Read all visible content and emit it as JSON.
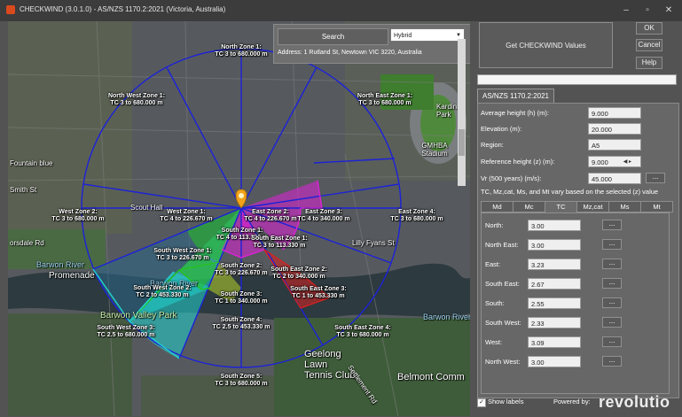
{
  "window": {
    "title": "CHECKWIND (3.0.1.0) - AS/NZS 1170.2:2021 (Victoria, Australia)",
    "minimize": "–",
    "maximize": "▫",
    "close": "✕"
  },
  "map": {
    "search_label": "Search",
    "map_type": "Hybrid",
    "address": "Address: 1 Rutland St, Newtown VIC 3220, Australia",
    "places": {
      "barwon_river_1": "Barwon River",
      "barwon_river_2": "Barwon River",
      "barwon_river_3": "Barwon River",
      "promenade": "Promenade",
      "park": "Barwon Valley Park",
      "belmont": "Belmont Comm",
      "tennis": "Geelong Lawn Tennis Club",
      "settlement": "Settlement Rd",
      "gmhba": "GMHBA Stadium",
      "fountain": "Fountain blue",
      "scout": "Scout Hall",
      "lilly_fyans": "Lilly Fyans St",
      "orsdale": "orsdale Rd",
      "smith": "Smith St",
      "kardinia": "Kardinia Park"
    },
    "outer_zones": [
      {
        "name": "North Zone 1:",
        "range": "TC 3 to 680.000 m"
      },
      {
        "name": "North East Zone 1:",
        "range": "TC 3 to 680.000 m"
      },
      {
        "name": "East Zone 4:",
        "range": "TC 3 to 680.000 m"
      },
      {
        "name": "South East Zone 4:",
        "range": "TC 3 to 680.000 m"
      },
      {
        "name": "South Zone 5:",
        "range": "TC 3 to 680.000 m"
      },
      {
        "name": "South West Zone 3:",
        "range": "TC 2.5 to 680.000 m"
      },
      {
        "name": "West Zone 2:",
        "range": "TC 3 to 680.000 m"
      },
      {
        "name": "North West Zone 1:",
        "range": "TC 3 to 680.000 m"
      }
    ],
    "inner_zones": [
      {
        "name": "West Zone 1:",
        "range": "TC 4 to 226.670 m"
      },
      {
        "name": "East Zone 2:",
        "range": "TC 4 to 226.670 m"
      },
      {
        "name": "East Zone 3:",
        "range": "TC 4 to 340.000 m"
      },
      {
        "name": "South Zone 1:",
        "range": "TC 4 to 113.330 m"
      },
      {
        "name": "South Zone 2:",
        "range": "TC 3 to 226.670 m"
      },
      {
        "name": "South Zone 3:",
        "range": "TC 1 to 340.000 m"
      },
      {
        "name": "South Zone 4:",
        "range": "TC 2.5 to 453.330 m"
      },
      {
        "name": "South West Zone 1:",
        "range": "TC 3 to 226.670 m"
      },
      {
        "name": "South West Zone 2:",
        "range": "TC 2 to 453.330 m"
      },
      {
        "name": "South East Zone 1:",
        "range": "TC 3 to 113.330 m"
      },
      {
        "name": "South East Zone 2:",
        "range": "TC 2 to 340.000 m"
      },
      {
        "name": "South East Zone 3:",
        "range": "TC 1 to 453.330 m"
      }
    ]
  },
  "panel": {
    "get_values": "Get CHECKWIND Values",
    "ok": "OK",
    "cancel": "Cancel",
    "help": "Help",
    "standard_tab": "AS/NZS 1170.2:2021",
    "avg_height_label": "Average height (h) (m):",
    "avg_height": "9.000",
    "elevation_label": "Elevation (m):",
    "elevation": "20.000",
    "region_label": "Region:",
    "region": "A5",
    "ref_height_label": "Reference height (z) (m):",
    "ref_height": "9.000",
    "vr_label": "Vr (500 years) (m/s):",
    "vr": "45.000",
    "vary_note": "TC, Mz,cat, Ms, and Mt vary based on the selected (z) value",
    "more": "...",
    "subtabs": [
      "Md",
      "Mc",
      "TC",
      "Mz,cat",
      "Ms",
      "Mt"
    ],
    "directions": [
      {
        "label": "North:",
        "value": "3.00"
      },
      {
        "label": "North East:",
        "value": "3.00"
      },
      {
        "label": "East:",
        "value": "3.23"
      },
      {
        "label": "South East:",
        "value": "2.67"
      },
      {
        "label": "South:",
        "value": "2.55"
      },
      {
        "label": "South West:",
        "value": "2.33"
      },
      {
        "label": "West:",
        "value": "3.09"
      },
      {
        "label": "North West:",
        "value": "3.00"
      }
    ],
    "show_labels": "Show labels",
    "powered_by": "Powered by:",
    "brand": "revolutio"
  },
  "colors": {
    "circle": "#1c22d8",
    "green": "#26c21e",
    "cyan": "#21d3d0",
    "magenta": "#e021d8",
    "red": "#d92020",
    "pin": "#f0a21a"
  }
}
